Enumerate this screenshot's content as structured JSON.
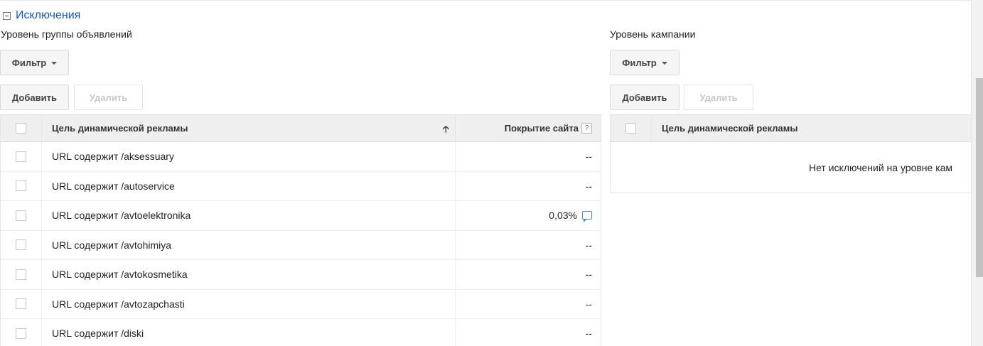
{
  "section": {
    "title": "Исключения"
  },
  "ad_group_level": {
    "label": "Уровень группы объявлений",
    "filter_label": "Фильтр",
    "add_label": "Добавить",
    "delete_label": "Удалить",
    "columns": {
      "target": "Цель динамической рекламы",
      "coverage": "Покрытие сайта",
      "help": "?"
    },
    "rows": [
      {
        "target": "URL содержит /aksessuary",
        "coverage": "--"
      },
      {
        "target": "URL содержит /autoservice",
        "coverage": "--"
      },
      {
        "target": "URL содержит /avtoelektronika",
        "coverage": "0,03%"
      },
      {
        "target": "URL содержит /avtohimiya",
        "coverage": "--"
      },
      {
        "target": "URL содержит /avtokosmetika",
        "coverage": "--"
      },
      {
        "target": "URL содержит /avtozapchasti",
        "coverage": "--"
      },
      {
        "target": "URL содержит /diski",
        "coverage": "--"
      }
    ]
  },
  "campaign_level": {
    "label": "Уровень кампании",
    "filter_label": "Фильтр",
    "add_label": "Добавить",
    "delete_label": "Удалить",
    "columns": {
      "target": "Цель динамической рекламы"
    },
    "empty_message": "Нет исключений на уровне кам"
  }
}
